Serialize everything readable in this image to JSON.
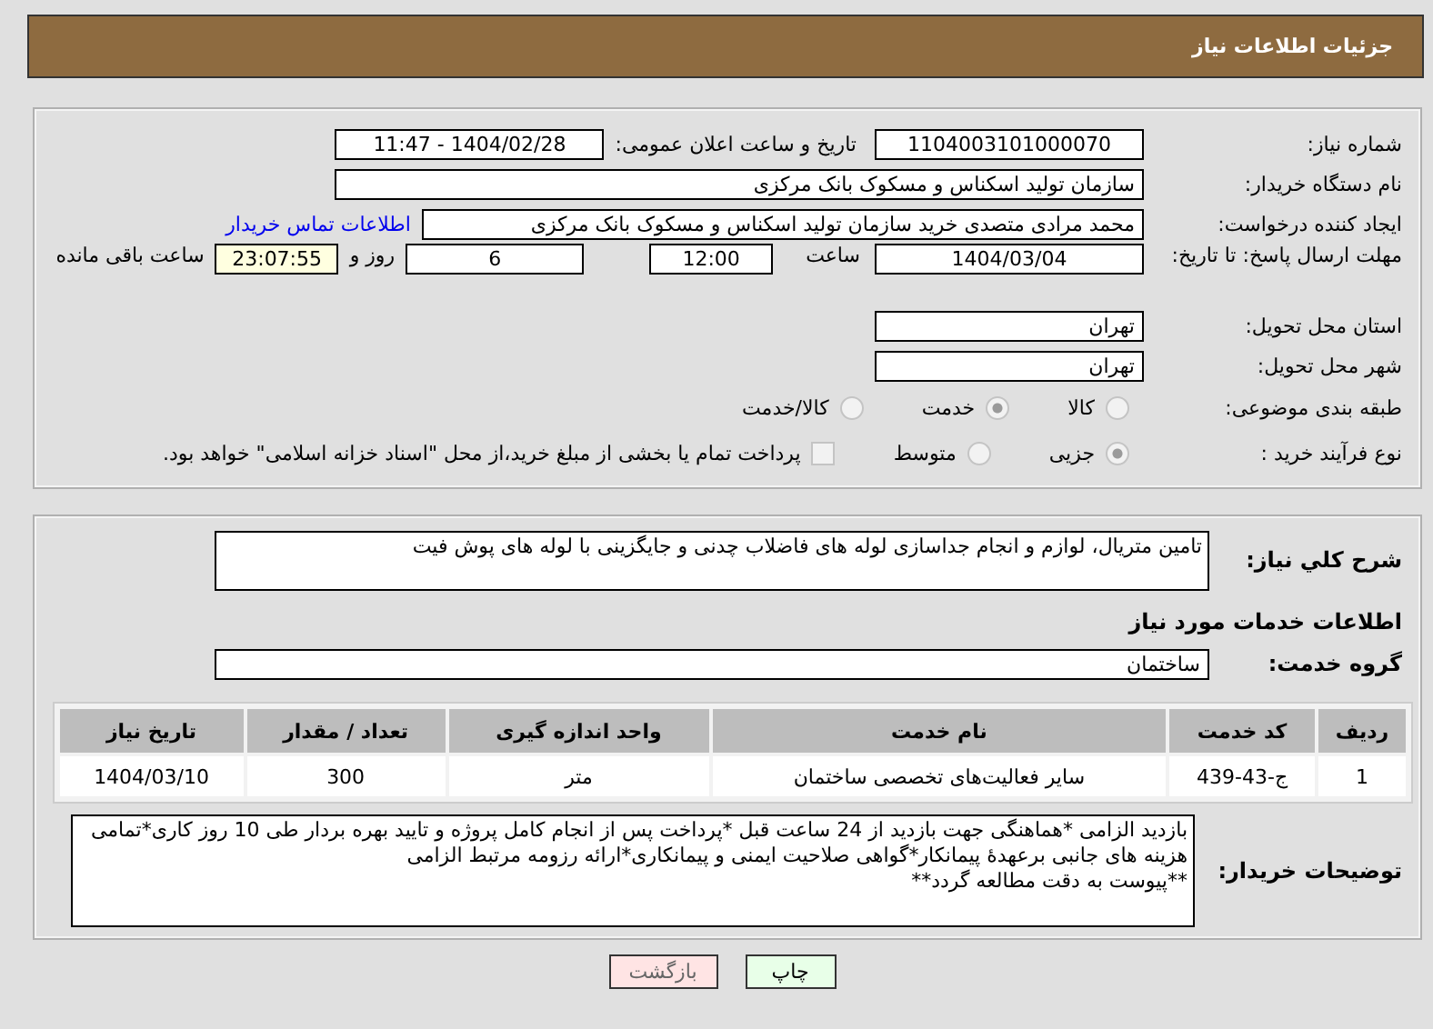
{
  "header": {
    "title": "جزئیات اطلاعات نیاز"
  },
  "need_number": {
    "label": "شماره نیاز:",
    "value": "1104003101000070"
  },
  "announce_date": {
    "label": "تاریخ و ساعت اعلان عمومی:",
    "value": "1404/02/28 - 11:47"
  },
  "buyer_org": {
    "label": "نام دستگاه خریدار:",
    "value": "سازمان تولید اسکناس و مسکوک بانک مرکزی"
  },
  "requester": {
    "label": "ایجاد کننده درخواست:",
    "value": "محمد مرادی متصدی خرید سازمان تولید اسکناس و مسکوک بانک مرکزی",
    "link": "اطلاعات تماس خریدار"
  },
  "deadline": {
    "label": "مهلت ارسال پاسخ: تا تاریخ:",
    "date": "1404/03/04",
    "time_label": "ساعت",
    "time": "12:00",
    "days": "6",
    "days_label": "روز و",
    "remaining": "23:07:55",
    "remaining_label": "ساعت باقی مانده"
  },
  "province": {
    "label": "استان محل تحویل:",
    "value": "تهران"
  },
  "city": {
    "label": "شهر محل تحویل:",
    "value": "تهران"
  },
  "category": {
    "label": "طبقه بندی موضوعی:",
    "options": [
      {
        "label": "کالا",
        "selected": false
      },
      {
        "label": "خدمت",
        "selected": true
      },
      {
        "label": "کالا/خدمت",
        "selected": false
      }
    ]
  },
  "purchase_type": {
    "label": "نوع فرآیند خرید :",
    "options": [
      {
        "label": "جزیی",
        "selected": true
      },
      {
        "label": "متوسط",
        "selected": false
      }
    ],
    "payment_note": {
      "checked": false,
      "text": "پرداخت تمام یا بخشی از مبلغ خرید،از محل \"اسناد خزانه اسلامی\" خواهد بود."
    }
  },
  "description": {
    "label": "شرح کلي نياز:",
    "value": "تامین متریال، لوازم و انجام جداسازی لوله های فاضلاب چدنی و جایگزینی با لوله های پوش فیت"
  },
  "services_heading": "اطلاعات خدمات مورد نياز",
  "service_group": {
    "label": "گروه خدمت:",
    "value": "ساختمان"
  },
  "table": {
    "columns": [
      "ردیف",
      "کد خدمت",
      "نام خدمت",
      "واحد اندازه گیری",
      "تعداد / مقدار",
      "تاریخ نیاز"
    ],
    "rows": [
      [
        "1",
        "ج-43-439",
        "سایر فعالیت‌های تخصصی ساختمان",
        "متر",
        "300",
        "1404/03/10"
      ]
    ]
  },
  "buyer_notes": {
    "label": "توضیحات خریدار:",
    "value": "بازدید الزامی *هماهنگی جهت بازدید از 24 ساعت قبل *پرداخت پس از انجام کامل پروژه و تایید بهره بردار طی 10 روز کاری*تمامی هزینه های جانبی برعهدهٔ پیمانکار*گواهی صلاحیت ایمنی و پیمانکاری*ارائه رزومه مرتبط الزامی\n**پیوست به دقت مطالعه گردد**"
  },
  "buttons": [
    {
      "label": "چاپ",
      "kind": "print"
    },
    {
      "label": "بازگشت",
      "kind": "back"
    }
  ]
}
